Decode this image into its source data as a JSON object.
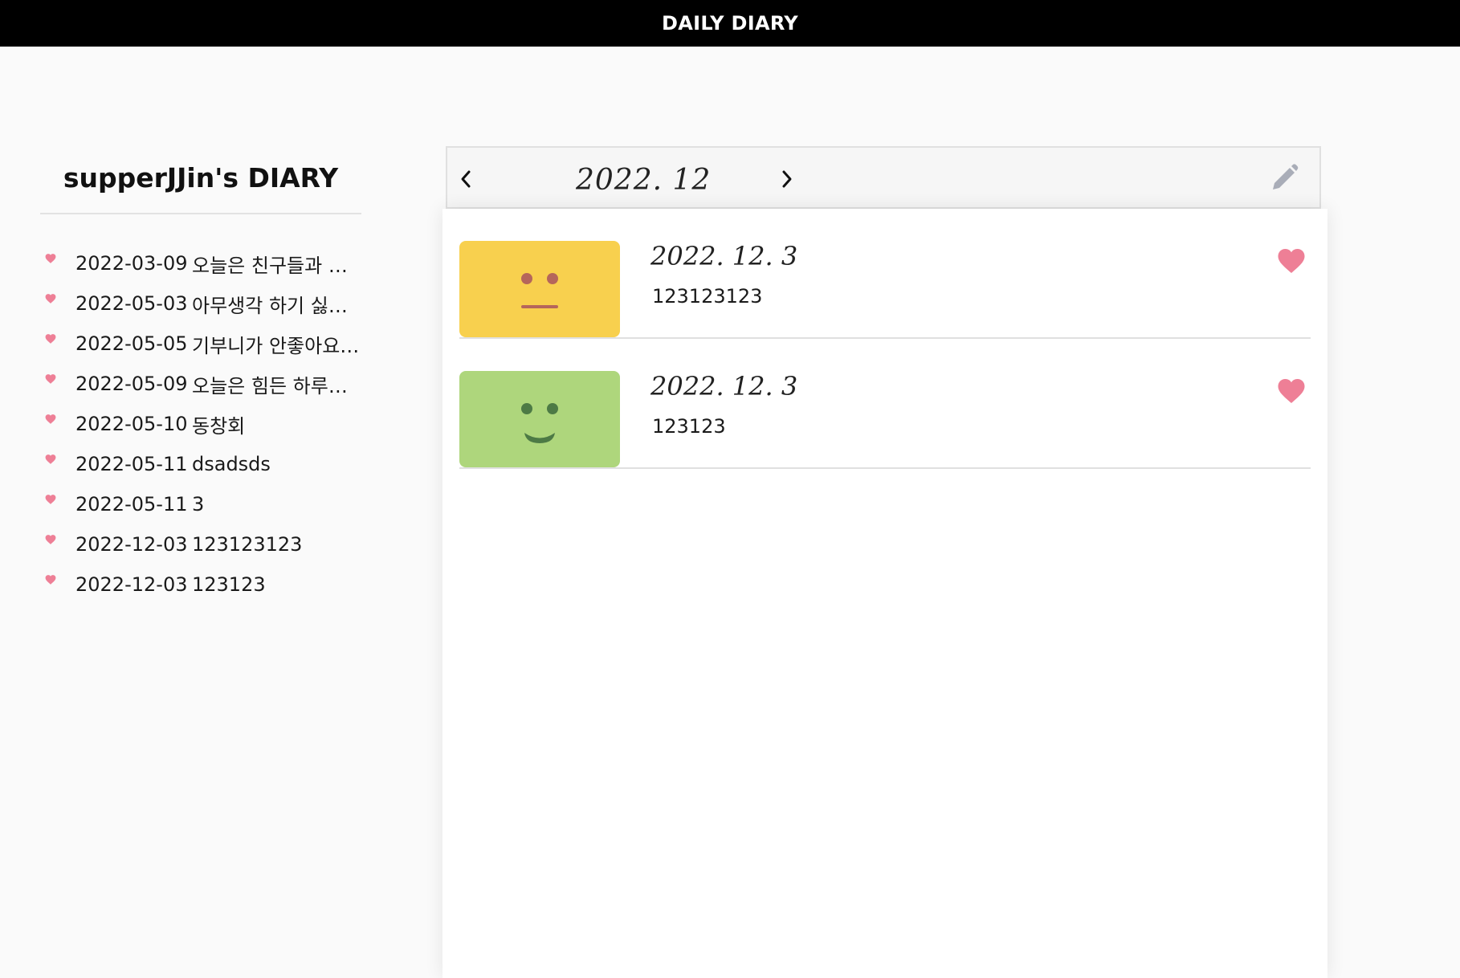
{
  "app": {
    "title": "DAILY DIARY"
  },
  "sidebar": {
    "title": "supperJJin's DIARY",
    "entries": [
      {
        "date": "2022-03-09",
        "text": "오늘은 친구들과 함께"
      },
      {
        "date": "2022-05-03",
        "text": "아무생각 하기 싫어…"
      },
      {
        "date": "2022-05-05",
        "text": "기부니가 안좋아요 …"
      },
      {
        "date": "2022-05-09",
        "text": "오늘은 힘든 하루였…"
      },
      {
        "date": "2022-05-10",
        "text": "동창회"
      },
      {
        "date": "2022-05-11",
        "text": "dsadsds"
      },
      {
        "date": "2022-05-11",
        "text": "3"
      },
      {
        "date": "2022-12-03",
        "text": "123123123"
      },
      {
        "date": "2022-12-03",
        "text": "123123"
      }
    ]
  },
  "calendar": {
    "month_label": "2022. 12",
    "prev_icon": "chevron-left-icon",
    "next_icon": "chevron-right-icon",
    "edit_icon": "pencil-icon"
  },
  "cards": [
    {
      "date": "2022. 12. 3",
      "text": "123123123",
      "mood": "neutral",
      "mood_color": "#f8d04e",
      "favorite": true
    },
    {
      "date": "2022. 12. 3",
      "text": "123123",
      "mood": "happy",
      "mood_color": "#aed67c",
      "favorite": true
    }
  ],
  "colors": {
    "heart": "#ee7f96",
    "neutral_face": "#b5665b",
    "happy_face": "#4d7a45",
    "pencil": "#a9adb8"
  }
}
